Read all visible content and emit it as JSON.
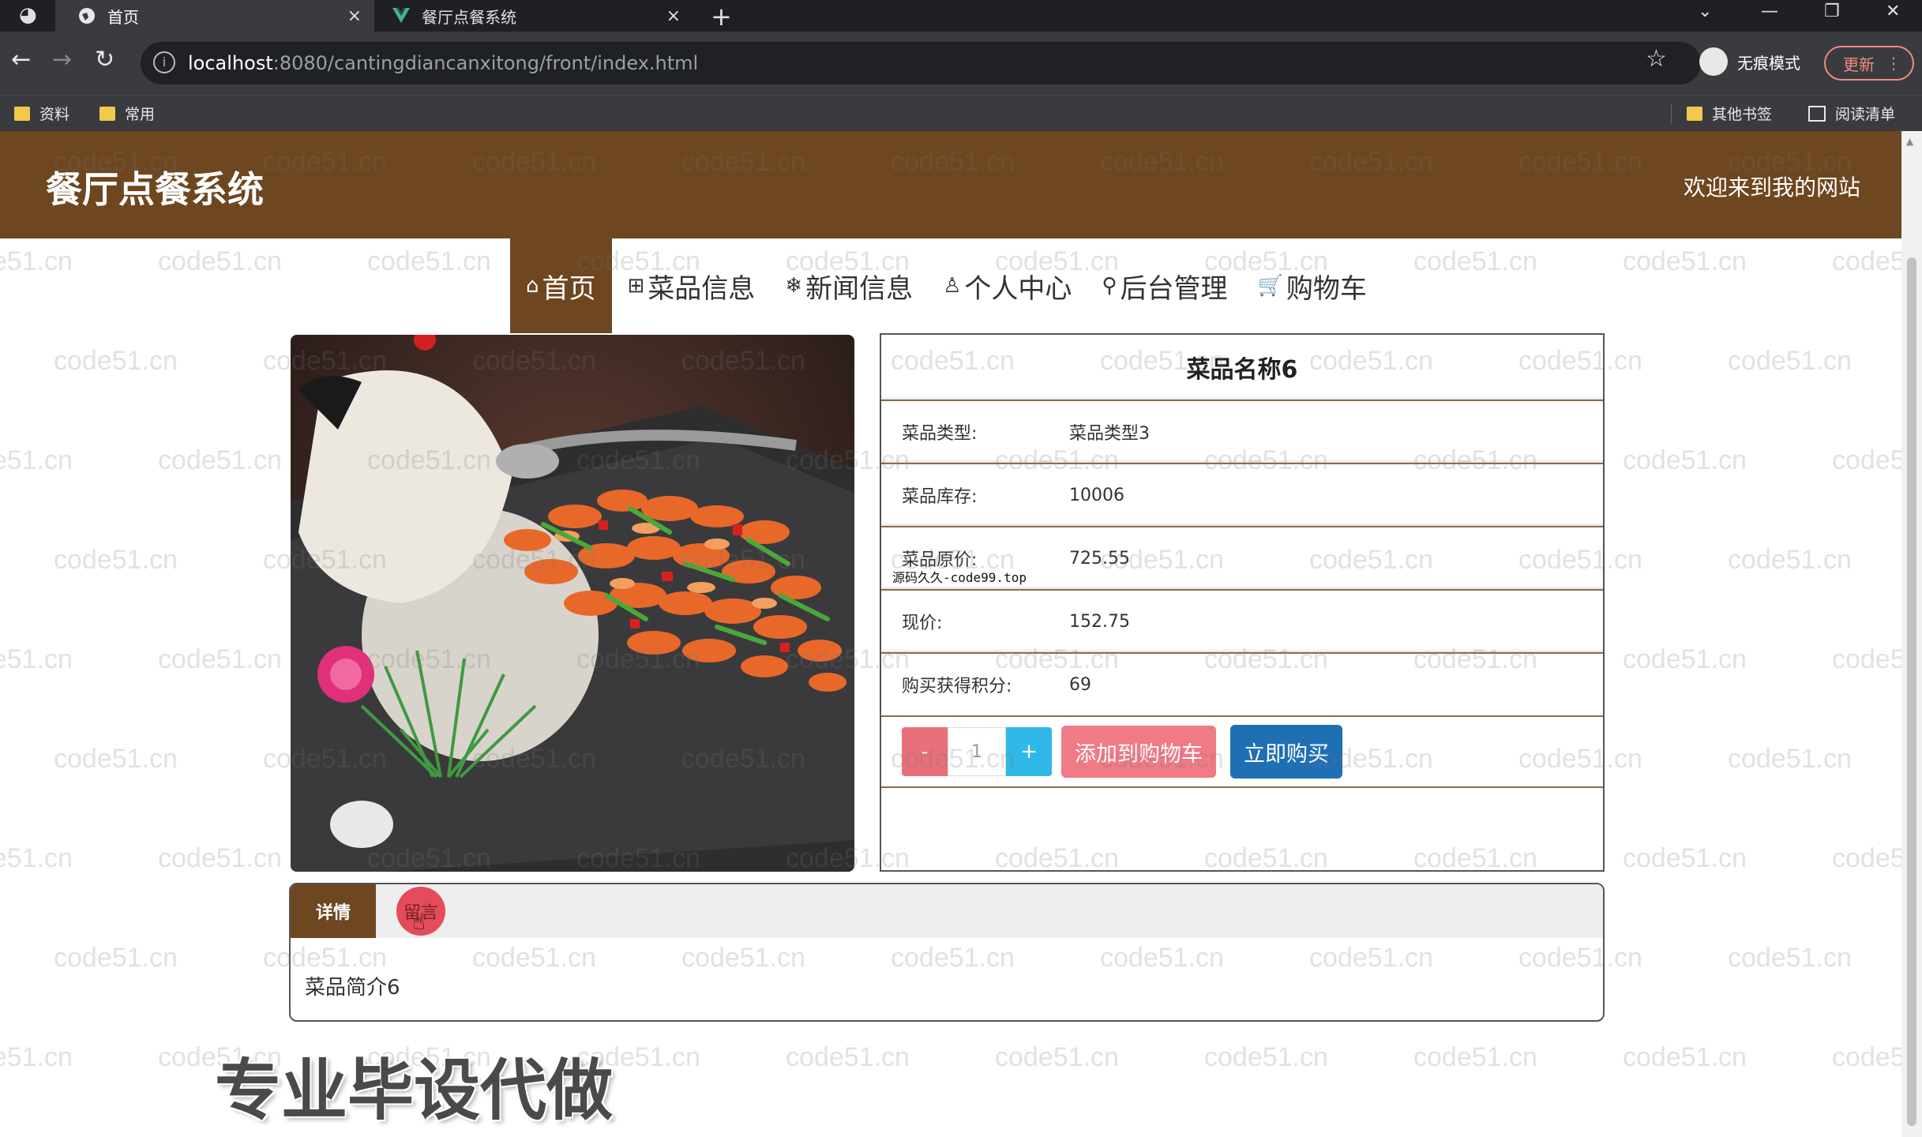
{
  "browser": {
    "tabs": [
      {
        "title": "首页",
        "close": "×"
      },
      {
        "title": "餐厅点餐系统",
        "close": "×"
      }
    ],
    "new_tab": "+",
    "url_host": "localhost",
    "url_path": ":8080/cantingdiancanxitong/front/index.html",
    "incognito_label": "无痕模式",
    "update_label": "更新",
    "bookmarks": [
      "资料",
      "常用"
    ],
    "other_bookmarks": "其他书签",
    "reading_list": "阅读清单"
  },
  "site": {
    "title": "餐厅点餐系统",
    "welcome": "欢迎来到我的网站"
  },
  "nav": [
    {
      "icon": "⌂",
      "label": "首页"
    },
    {
      "icon": "⊞",
      "label": "菜品信息"
    },
    {
      "icon": "❄",
      "label": "新闻信息"
    },
    {
      "icon": "♙",
      "label": "个人中心"
    },
    {
      "icon": "⚲",
      "label": "后台管理"
    },
    {
      "icon": "🛒",
      "label": "购物车"
    }
  ],
  "dish": {
    "name": "菜品名称6",
    "fields": [
      {
        "label": "菜品类型:",
        "value": "菜品类型3"
      },
      {
        "label": "菜品库存:",
        "value": "10006"
      },
      {
        "label": "菜品原价:",
        "value": "725.55"
      },
      {
        "label": "现价:",
        "value": "152.75"
      },
      {
        "label": "购买获得积分:",
        "value": "69"
      }
    ],
    "quantity": "1",
    "minus": "-",
    "plus": "+",
    "add_to_cart": "添加到购物车",
    "buy_now": "立即购买"
  },
  "tabs": {
    "detail": "详情",
    "message": "留言",
    "content": "菜品简介6"
  },
  "overlay": {
    "source_text": "源码久久-code99.top",
    "promo": "专业毕设代做",
    "watermark": "code51.cn"
  },
  "colors": {
    "brand_brown": "#6e4620",
    "cart_pink": "#f07a85",
    "buy_blue": "#1f6fb5",
    "plus_cyan": "#30b8e8"
  }
}
